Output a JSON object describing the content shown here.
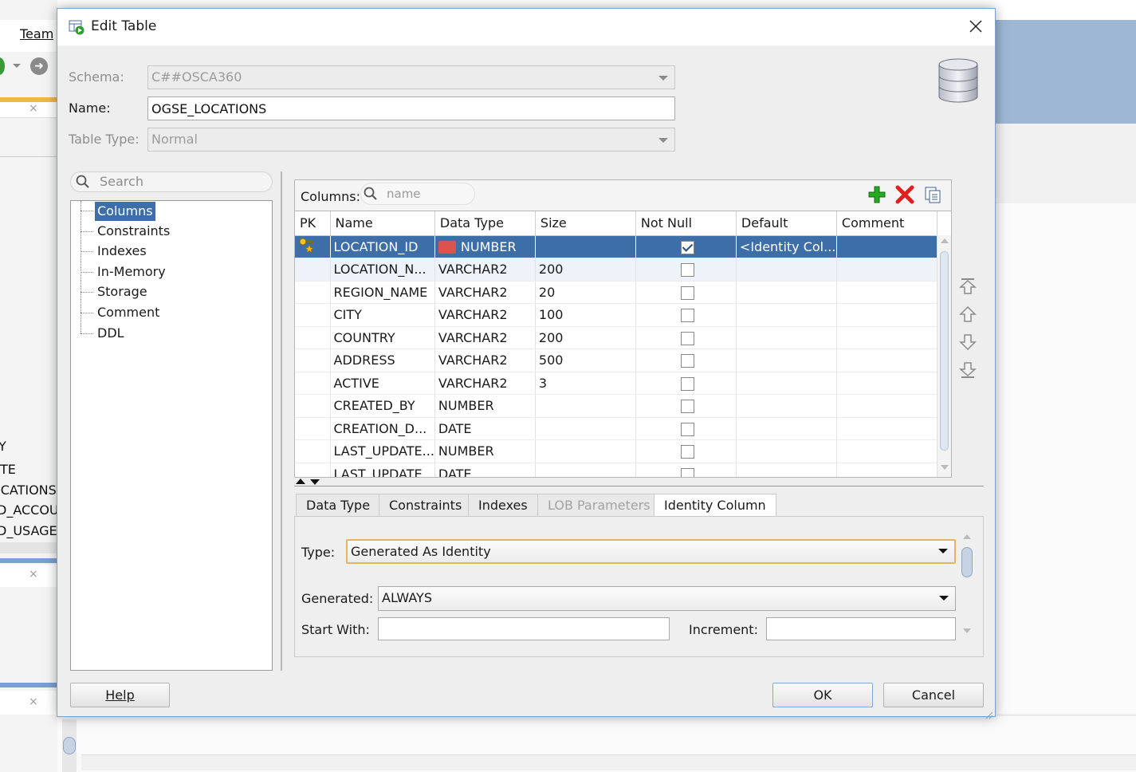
{
  "background": {
    "menu_team": "Team",
    "left_list": [
      "Y",
      "TE",
      "ICATIONS",
      "D_ACCOU",
      "D_USAGE"
    ]
  },
  "dialog": {
    "title": "Edit Table",
    "schema_label": "Schema:",
    "schema_value": "C##OSCA360",
    "name_label": "Name:",
    "name_value": "OGSE_LOCATIONS",
    "table_type_label": "Table Type:",
    "table_type_value": "Normal",
    "search_placeholder": "Search",
    "nav_items": [
      "Columns",
      "Constraints",
      "Indexes",
      "In-Memory",
      "Storage",
      "Comment",
      "DDL"
    ],
    "columns_label": "Columns:",
    "columns_filter_placeholder": "name",
    "grid_headers": [
      "PK",
      "Name",
      "Data Type",
      "Size",
      "Not Null",
      "Default",
      "Comment"
    ],
    "rows": [
      {
        "pk": true,
        "name": "LOCATION_ID",
        "type": "NUMBER",
        "size": "",
        "not_null": true,
        "default": "<Identity Col...",
        "comment": ""
      },
      {
        "pk": false,
        "name": "LOCATION_N...",
        "type": "VARCHAR2",
        "size": "200",
        "not_null": false,
        "default": "",
        "comment": ""
      },
      {
        "pk": false,
        "name": "REGION_NAME",
        "type": "VARCHAR2",
        "size": "20",
        "not_null": false,
        "default": "",
        "comment": ""
      },
      {
        "pk": false,
        "name": "CITY",
        "type": "VARCHAR2",
        "size": "100",
        "not_null": false,
        "default": "",
        "comment": ""
      },
      {
        "pk": false,
        "name": "COUNTRY",
        "type": "VARCHAR2",
        "size": "200",
        "not_null": false,
        "default": "",
        "comment": ""
      },
      {
        "pk": false,
        "name": "ADDRESS",
        "type": "VARCHAR2",
        "size": "500",
        "not_null": false,
        "default": "",
        "comment": ""
      },
      {
        "pk": false,
        "name": "ACTIVE",
        "type": "VARCHAR2",
        "size": "3",
        "not_null": false,
        "default": "",
        "comment": ""
      },
      {
        "pk": false,
        "name": "CREATED_BY",
        "type": "NUMBER",
        "size": "",
        "not_null": false,
        "default": "",
        "comment": ""
      },
      {
        "pk": false,
        "name": "CREATION_D...",
        "type": "DATE",
        "size": "",
        "not_null": false,
        "default": "",
        "comment": ""
      },
      {
        "pk": false,
        "name": "LAST_UPDATE...",
        "type": "NUMBER",
        "size": "",
        "not_null": false,
        "default": "",
        "comment": ""
      },
      {
        "pk": false,
        "name": "LAST_UPDATE...",
        "type": "DATE",
        "size": "",
        "not_null": false,
        "default": "",
        "comment": ""
      }
    ],
    "detail_tabs": [
      "Data Type",
      "Constraints",
      "Indexes",
      "LOB Parameters",
      "Identity Column"
    ],
    "active_tab": "Identity Column",
    "type_label": "Type:",
    "type_value": "Generated As Identity",
    "generated_label": "Generated:",
    "generated_value": "ALWAYS",
    "start_with_label": "Start With:",
    "start_with_value": "",
    "increment_label": "Increment:",
    "increment_value": "",
    "help_label": "Help",
    "ok_label": "OK",
    "cancel_label": "Cancel"
  },
  "colors": {
    "selection": "#3d6ea8",
    "accent_blue": "#9db7d4",
    "add_green": "#27a822",
    "delete_red": "#e02020"
  }
}
